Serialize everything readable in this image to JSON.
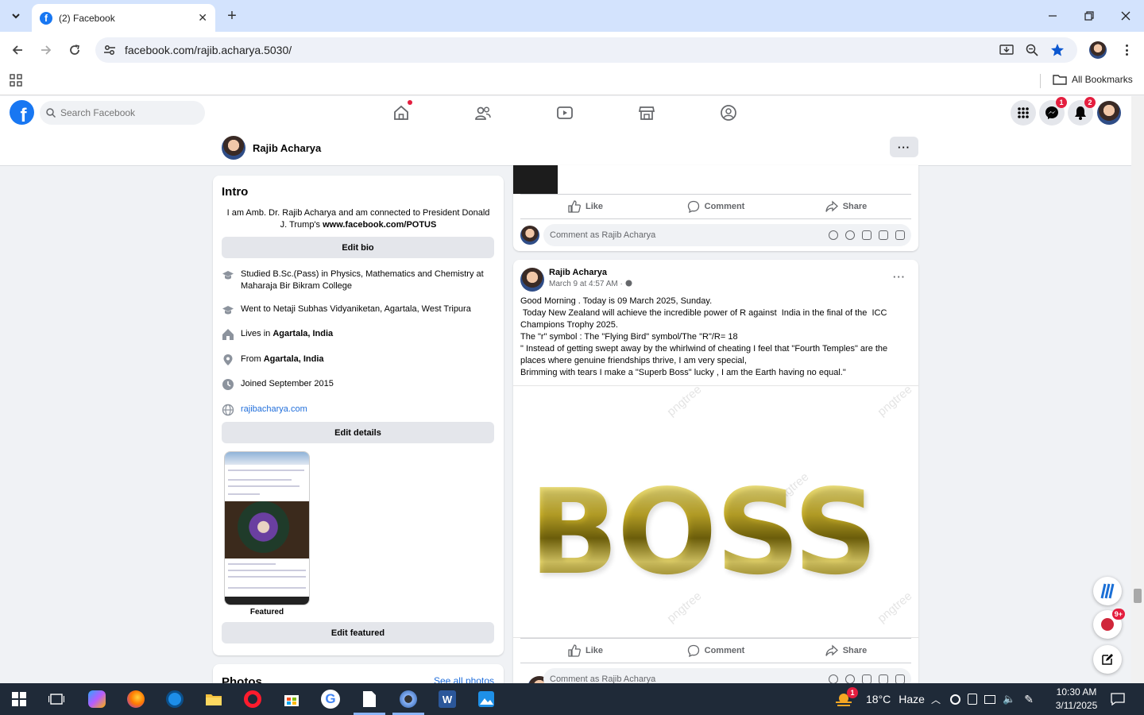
{
  "browser": {
    "tab_title": "(2) Facebook",
    "url": "facebook.com/rajib.acharya.5030/",
    "bookmarks_label": "All Bookmarks"
  },
  "facebook": {
    "search_placeholder": "Search Facebook",
    "messenger_badge": "1",
    "notifications_badge": "2"
  },
  "profile": {
    "name": "Rajib Acharya"
  },
  "intro": {
    "title": "Intro",
    "bio_text": "I am Amb. Dr. Rajib Acharya and am connected to President Donald J. Trump's ",
    "bio_link": "www.facebook.com/POTUS",
    "edit_bio": "Edit bio",
    "studied": "Studied B.Sc.(Pass) in Physics, Mathematics and Chemistry at Maharaja Bir Bikram College",
    "went_to": "Went to Netaji Subhas Vidyaniketan, Agartala, West Tripura",
    "lives_prefix": "Lives in ",
    "lives_place": "Agartala, India",
    "from_prefix": "From ",
    "from_place": "Agartala, India",
    "joined": "Joined September 2015",
    "website": "rajibacharya.com",
    "edit_details": "Edit details",
    "featured_label": "Featured",
    "edit_featured": "Edit featured"
  },
  "photos": {
    "title": "Photos",
    "see_all": "See all photos"
  },
  "post_actions": {
    "like": "Like",
    "comment": "Comment",
    "share": "Share",
    "comment_placeholder": "Comment as Rajib Acharya"
  },
  "post": {
    "author": "Rajib Acharya",
    "time": "March 9 at 4:57 AM ·",
    "lines": [
      "Good Morning . Today is 09 March 2025, Sunday.",
      " Today New Zealand will achieve the incredible power of R against  India in the final of the  ICC",
      "Champions Trophy 2025.",
      "The \"r\" symbol : The \"Flying Bird\" symbol/The \"R\"/R= 18",
      "\" Instead of getting swept away by the whirlwind of cheating I feel that \"Fourth Temples\" are the",
      "places where genuine friendships thrive, I am very special,",
      "Brimming with tears I make a \"Superb Boss\" lucky , I am the Earth having no equal.\""
    ],
    "image_text": "BOSS"
  },
  "widgets": {
    "news_badge": "9+"
  },
  "taskbar": {
    "weather_temp": "18°C",
    "weather_desc": "Haze",
    "weather_badge": "1",
    "time": "10:30 AM",
    "date": "3/11/2025"
  }
}
